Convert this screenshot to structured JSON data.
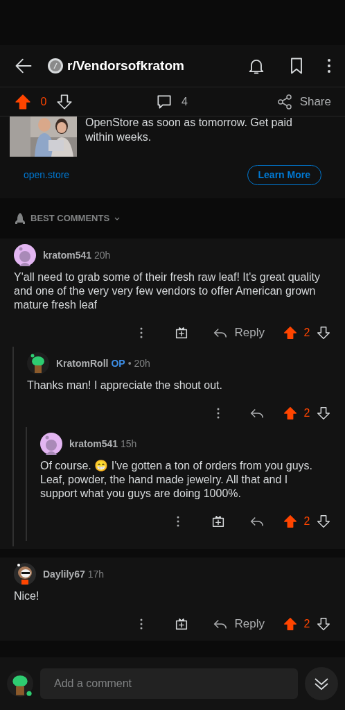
{
  "header": {
    "title": "r/Vendorsofkratom"
  },
  "post_bar": {
    "upvoted": true,
    "score": "0",
    "comments": "4",
    "share": "Share"
  },
  "ad": {
    "text": "OpenStore as soon as tomorrow. Get paid within weeks.",
    "domain": "open.store",
    "button": "Learn More"
  },
  "sort": {
    "label": "BEST COMMENTS"
  },
  "comments": [
    {
      "author": "kratom541",
      "op": false,
      "time": "20h",
      "avatar": {
        "kind": "purple"
      },
      "body": "Y'all need to grab some of their fresh raw leaf! It's great quality and one of the very very few vendors to offer American grown mature fresh leaf",
      "gift": true,
      "reply": "Reply",
      "upvoted": true,
      "score": "2",
      "children": [
        {
          "author": "KratomRoll",
          "op": true,
          "op_label": "OP",
          "time": "• 20h",
          "avatar": {
            "kind": "green"
          },
          "body": "Thanks man! I appreciate the shout out.",
          "gift": false,
          "upvoted": true,
          "score": "2",
          "children": [
            {
              "author": "kratom541",
              "op": false,
              "time": "15h",
              "avatar": {
                "kind": "purple"
              },
              "body": "Of course. 😁 I've gotten a ton of orders from you guys. Leaf, powder, the hand made jewelry. All that and I support what you guys are doing 1000%.",
              "gift": true,
              "upvoted": true,
              "score": "2"
            }
          ]
        }
      ]
    },
    {
      "author": "Daylily67",
      "op": false,
      "time": "17h",
      "avatar": {
        "kind": "girl"
      },
      "body": "Nice!",
      "gift": true,
      "reply": "Reply",
      "upvoted": true,
      "score": "2"
    }
  ],
  "composer": {
    "placeholder": "Add a comment"
  }
}
